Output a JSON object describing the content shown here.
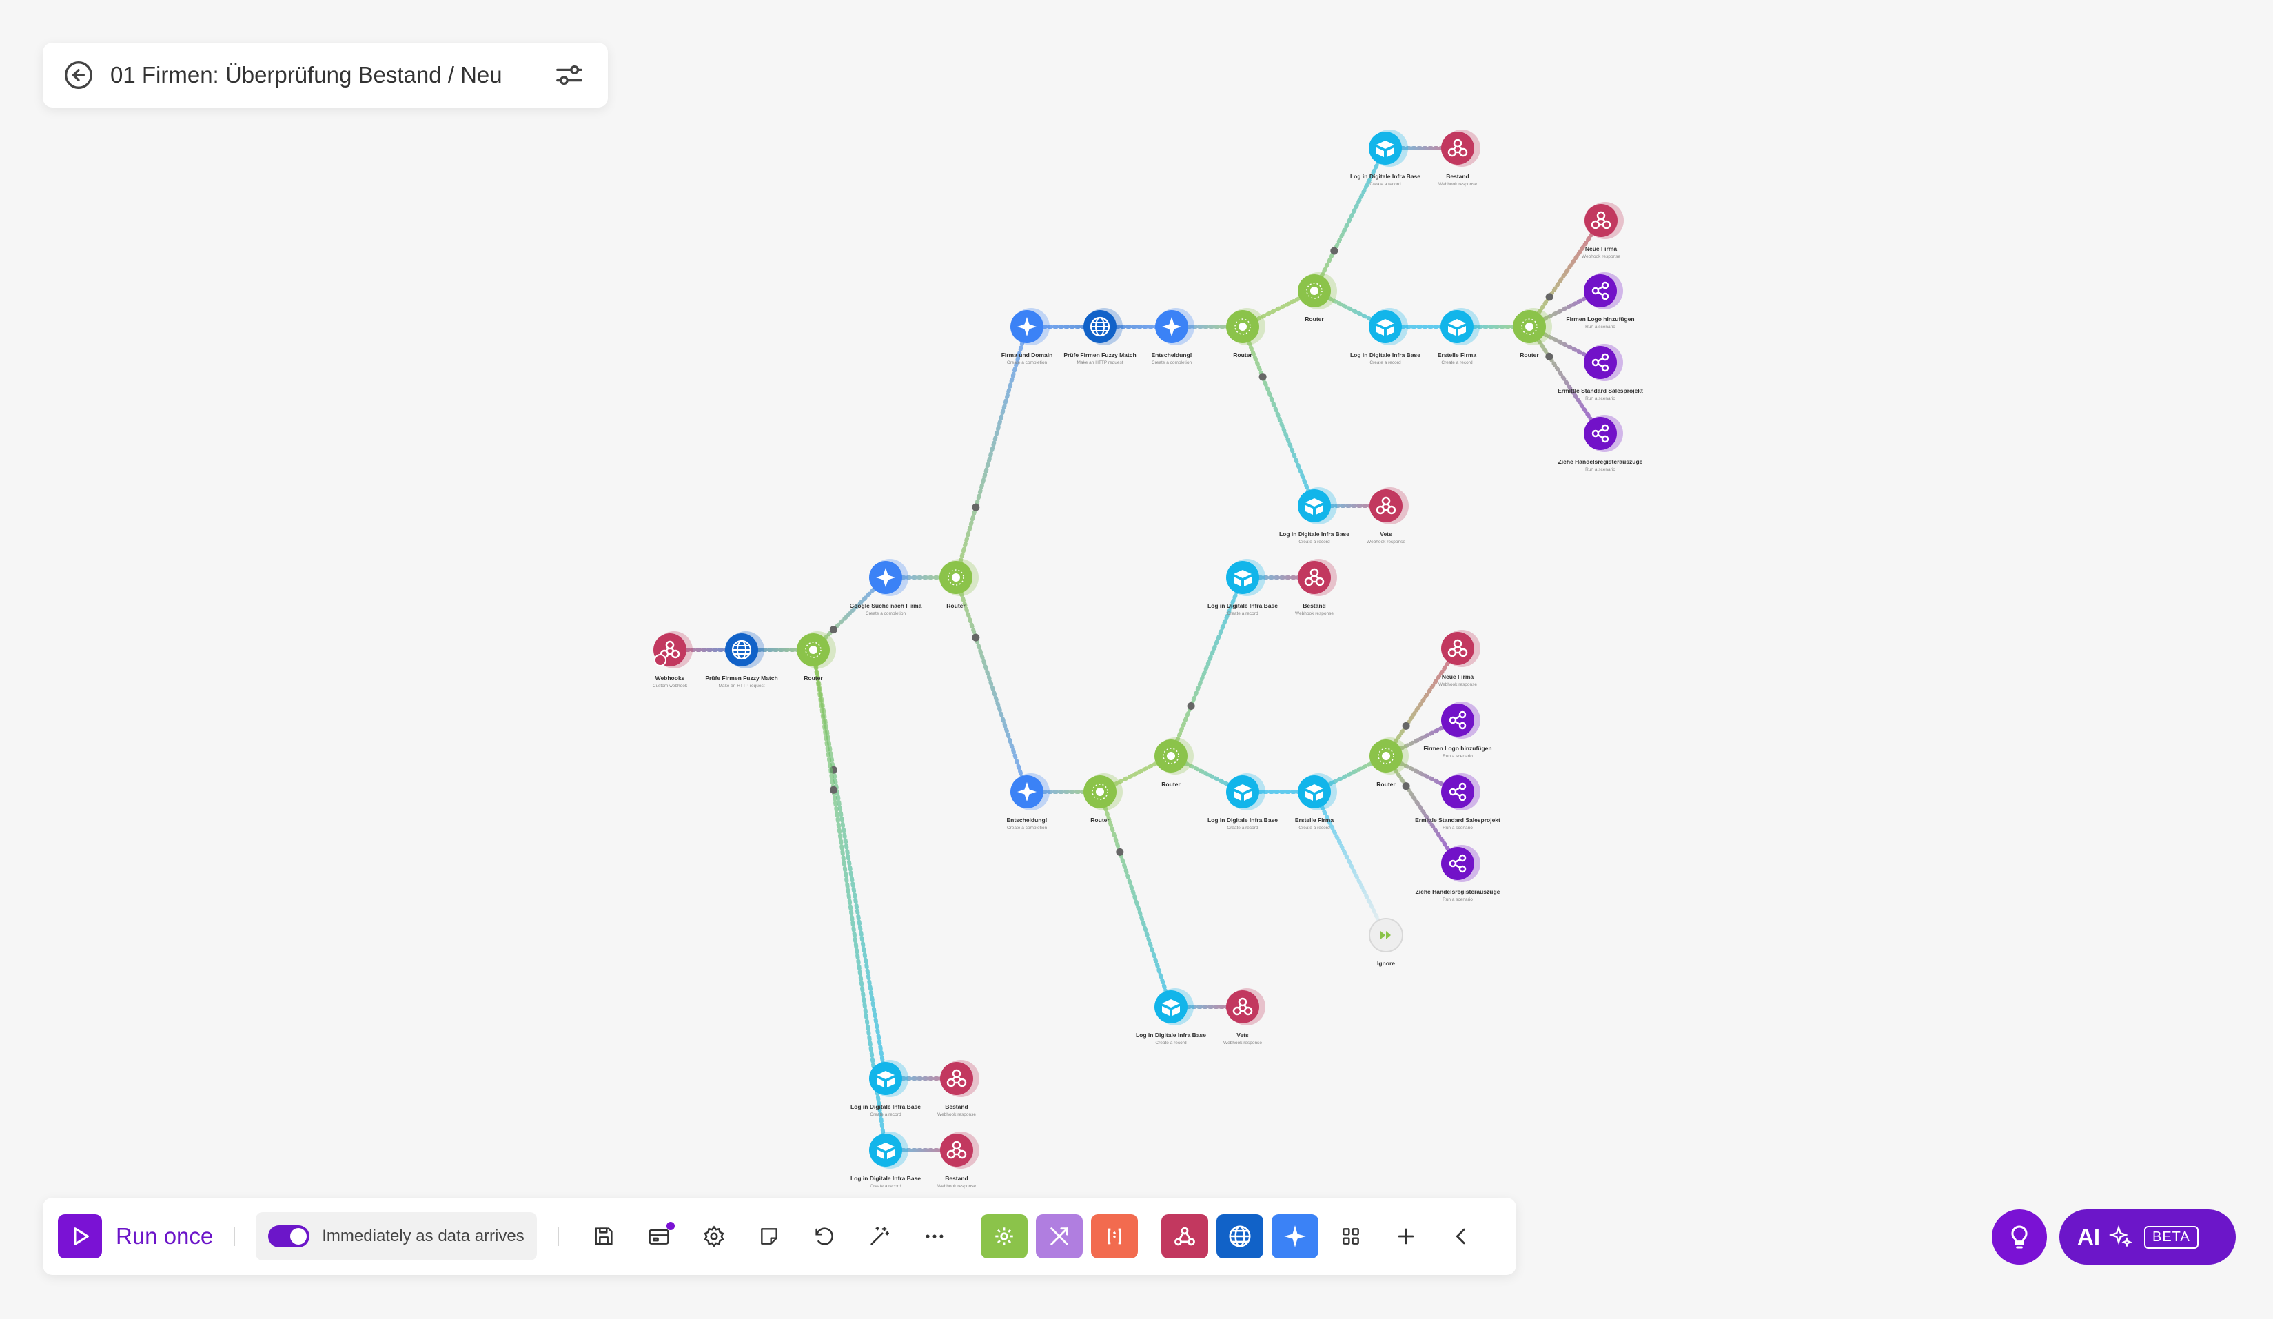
{
  "scenario": {
    "title": "01 Firmen: Überprüfung Bestand / Neu"
  },
  "toolbar": {
    "run_label": "Run once",
    "schedule_label": "Immediately as data arrives"
  },
  "ai": {
    "label": "AI",
    "badge": "BETA"
  },
  "colors": {
    "webhook": "#c2385f",
    "http": "#1162c8",
    "ai": "#3b82f6",
    "router": "#8bc34a",
    "airtable": "#12b5ea",
    "share": "#7212c8",
    "ignore": "#eeeeee",
    "accent": "#7a12d4"
  },
  "nodes": [
    {
      "id": "n1",
      "type": "webhook",
      "label": "Webhooks",
      "sub": "Custom webhook"
    },
    {
      "id": "n2",
      "type": "http",
      "label": "Prüfe Firmen Fuzzy Match",
      "sub": "Make an HTTP request"
    },
    {
      "id": "n3",
      "type": "router",
      "label": "Router",
      "sub": ""
    },
    {
      "id": "n4",
      "type": "ai",
      "label": "Google Suche nach Firma",
      "sub": "Create a completion"
    },
    {
      "id": "n5",
      "type": "router",
      "label": "Router",
      "sub": ""
    },
    {
      "id": "n6",
      "type": "ai",
      "label": "Firma und Domain",
      "sub": "Create a completion"
    },
    {
      "id": "n7",
      "type": "http",
      "label": "Prüfe Firmen Fuzzy Match",
      "sub": "Make an HTTP request"
    },
    {
      "id": "n8",
      "type": "ai",
      "label": "Entscheidung!",
      "sub": "Create a completion"
    },
    {
      "id": "n9",
      "type": "router",
      "label": "Router",
      "sub": ""
    },
    {
      "id": "n10",
      "type": "router",
      "label": "Router",
      "sub": ""
    },
    {
      "id": "n11",
      "type": "airtable",
      "label": "Log in Digitale Infra Base",
      "sub": "Create a record"
    },
    {
      "id": "n12",
      "type": "webhook",
      "label": "Bestand",
      "sub": "Webhook response"
    },
    {
      "id": "n13",
      "type": "airtable",
      "label": "Log in Digitale Infra Base",
      "sub": "Create a record"
    },
    {
      "id": "n14",
      "type": "airtable",
      "label": "Erstelle Firma",
      "sub": "Create a record"
    },
    {
      "id": "n15",
      "type": "router",
      "label": "Router",
      "sub": ""
    },
    {
      "id": "n16",
      "type": "webhook",
      "label": "Neue Firma",
      "sub": "Webhook response"
    },
    {
      "id": "n17",
      "type": "share",
      "label": "Firmen Logo hinzufügen",
      "sub": "Run a scenario"
    },
    {
      "id": "n18",
      "type": "share",
      "label": "Ermittle Standard Salesprojekt",
      "sub": "Run a scenario"
    },
    {
      "id": "n19",
      "type": "share",
      "label": "Ziehe Handelsregisterauszüge",
      "sub": "Run a scenario"
    },
    {
      "id": "n20",
      "type": "airtable",
      "label": "Log in Digitale Infra Base",
      "sub": "Create a record"
    },
    {
      "id": "n21",
      "type": "webhook",
      "label": "Vets",
      "sub": "Webhook response"
    },
    {
      "id": "n22",
      "type": "ai",
      "label": "Entscheidung!",
      "sub": "Create a completion"
    },
    {
      "id": "n23",
      "type": "router",
      "label": "Router",
      "sub": ""
    },
    {
      "id": "n24",
      "type": "router",
      "label": "Router",
      "sub": ""
    },
    {
      "id": "n25",
      "type": "airtable",
      "label": "Log in Digitale Infra Base",
      "sub": "Create a record"
    },
    {
      "id": "n26",
      "type": "webhook",
      "label": "Bestand",
      "sub": "Webhook response"
    },
    {
      "id": "n27",
      "type": "airtable",
      "label": "Log in Digitale Infra Base",
      "sub": "Create a record"
    },
    {
      "id": "n28",
      "type": "airtable",
      "label": "Erstelle Firma",
      "sub": "Create a record"
    },
    {
      "id": "n29",
      "type": "router",
      "label": "Router",
      "sub": ""
    },
    {
      "id": "n30",
      "type": "webhook",
      "label": "Neue Firma",
      "sub": "Webhook response"
    },
    {
      "id": "n31",
      "type": "share",
      "label": "Firmen Logo hinzufügen",
      "sub": "Run a scenario"
    },
    {
      "id": "n32",
      "type": "share",
      "label": "Ermittle Standard Salesprojekt",
      "sub": "Run a scenario"
    },
    {
      "id": "n33",
      "type": "share",
      "label": "Ziehe Handelsregisterauszüge",
      "sub": "Run a scenario"
    },
    {
      "id": "n34",
      "type": "ignore",
      "label": "Ignore",
      "sub": ""
    },
    {
      "id": "n35",
      "type": "airtable",
      "label": "Log in Digitale Infra Base",
      "sub": "Create a record"
    },
    {
      "id": "n36",
      "type": "webhook",
      "label": "Vets",
      "sub": "Webhook response"
    },
    {
      "id": "n37",
      "type": "airtable",
      "label": "Log in Digitale Infra Base",
      "sub": "Create a record"
    },
    {
      "id": "n38",
      "type": "webhook",
      "label": "Bestand",
      "sub": "Webhook response"
    },
    {
      "id": "n39",
      "type": "airtable",
      "label": "Log in Digitale Infra Base",
      "sub": "Create a record"
    },
    {
      "id": "n40",
      "type": "webhook",
      "label": "Bestand",
      "sub": "Webhook response"
    }
  ],
  "edges": [
    [
      "n1",
      "n2"
    ],
    [
      "n2",
      "n3"
    ],
    [
      "n3",
      "n4"
    ],
    [
      "n3",
      "n37"
    ],
    [
      "n3",
      "n39"
    ],
    [
      "n4",
      "n5"
    ],
    [
      "n5",
      "n6"
    ],
    [
      "n5",
      "n22"
    ],
    [
      "n6",
      "n7"
    ],
    [
      "n7",
      "n8"
    ],
    [
      "n8",
      "n9"
    ],
    [
      "n9",
      "n10"
    ],
    [
      "n9",
      "n20"
    ],
    [
      "n10",
      "n11"
    ],
    [
      "n10",
      "n13"
    ],
    [
      "n11",
      "n12"
    ],
    [
      "n13",
      "n14"
    ],
    [
      "n14",
      "n15"
    ],
    [
      "n15",
      "n16"
    ],
    [
      "n15",
      "n17"
    ],
    [
      "n15",
      "n18"
    ],
    [
      "n15",
      "n19"
    ],
    [
      "n20",
      "n21"
    ],
    [
      "n22",
      "n23"
    ],
    [
      "n23",
      "n24"
    ],
    [
      "n23",
      "n35"
    ],
    [
      "n24",
      "n25"
    ],
    [
      "n24",
      "n27"
    ],
    [
      "n25",
      "n26"
    ],
    [
      "n27",
      "n28"
    ],
    [
      "n28",
      "n29"
    ],
    [
      "n28",
      "n34"
    ],
    [
      "n29",
      "n30"
    ],
    [
      "n29",
      "n31"
    ],
    [
      "n29",
      "n32"
    ],
    [
      "n29",
      "n33"
    ],
    [
      "n35",
      "n36"
    ],
    [
      "n37",
      "n38"
    ],
    [
      "n39",
      "n40"
    ]
  ]
}
